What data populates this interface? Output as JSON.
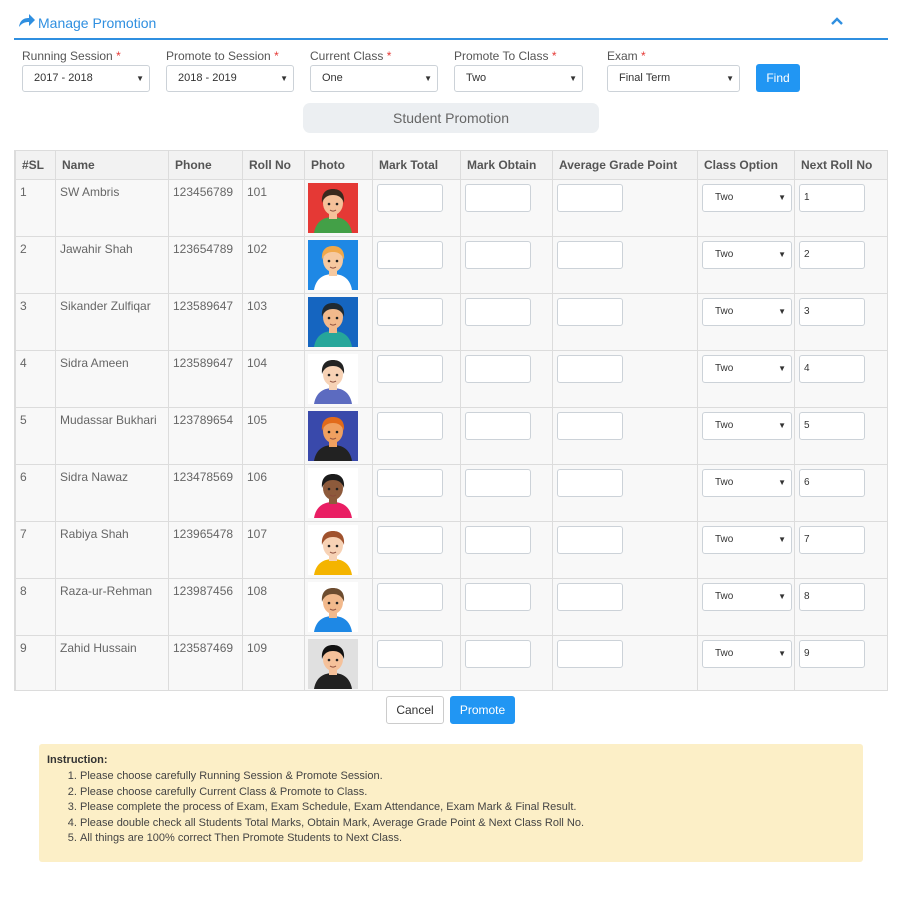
{
  "header": {
    "title": "Manage Promotion"
  },
  "filters": [
    {
      "label": "Running Session",
      "value": "2017 - 2018"
    },
    {
      "label": "Promote to Session",
      "value": "2018 - 2019"
    },
    {
      "label": "Current Class",
      "value": "One"
    },
    {
      "label": "Promote To Class",
      "value": "Two"
    },
    {
      "label": "Exam",
      "value": "Final Term"
    }
  ],
  "required_marker": "*",
  "find_label": "Find",
  "section_title": "Student Promotion",
  "table": {
    "columns": [
      "#SL",
      "Name",
      "Phone",
      "Roll No",
      "Photo",
      "Mark Total",
      "Mark Obtain",
      "Average Grade Point",
      "Class Option",
      "Next Roll No"
    ],
    "rows": [
      {
        "sl": "1",
        "name": "SW Ambris",
        "phone": "123456789",
        "roll": "101",
        "class_option": "Two",
        "next_roll": "1"
      },
      {
        "sl": "2",
        "name": "Jawahir Shah",
        "phone": "123654789",
        "roll": "102",
        "class_option": "Two",
        "next_roll": "2"
      },
      {
        "sl": "3",
        "name": "Sikander Zulfiqar",
        "phone": "123589647",
        "roll": "103",
        "class_option": "Two",
        "next_roll": "3"
      },
      {
        "sl": "4",
        "name": "Sidra Ameen",
        "phone": "123589647",
        "roll": "104",
        "class_option": "Two",
        "next_roll": "4"
      },
      {
        "sl": "5",
        "name": "Mudassar Bukhari",
        "phone": "123789654",
        "roll": "105",
        "class_option": "Two",
        "next_roll": "5"
      },
      {
        "sl": "6",
        "name": "Sidra Nawaz",
        "phone": "123478569",
        "roll": "106",
        "class_option": "Two",
        "next_roll": "6"
      },
      {
        "sl": "7",
        "name": "Rabiya Shah",
        "phone": "123965478",
        "roll": "107",
        "class_option": "Two",
        "next_roll": "7"
      },
      {
        "sl": "8",
        "name": "Raza-ur-Rehman",
        "phone": "123987456",
        "roll": "108",
        "class_option": "Two",
        "next_roll": "8"
      },
      {
        "sl": "9",
        "name": "Zahid Hussain",
        "phone": "123587469",
        "roll": "109",
        "class_option": "Two",
        "next_roll": "9"
      }
    ]
  },
  "avatars": [
    {
      "bg": "#e53935",
      "skin": "#f5c19a",
      "hair": "#3a2a1e",
      "shirt": "#43a047"
    },
    {
      "bg": "#1e88e5",
      "skin": "#f6c9a0",
      "hair": "#f0a84a",
      "shirt": "#ffffff"
    },
    {
      "bg": "#1565c0",
      "skin": "#f2b98c",
      "hair": "#1f2a33",
      "shirt": "#26a69a"
    },
    {
      "bg": "#ffffff",
      "skin": "#f7d2b5",
      "hair": "#222222",
      "shirt": "#5c6bc0"
    },
    {
      "bg": "#3949ab",
      "skin": "#f0a060",
      "hair": "#e26a1a",
      "shirt": "#222222"
    },
    {
      "bg": "#ffffff",
      "skin": "#8d5a3b",
      "hair": "#1b1b1b",
      "shirt": "#e91e63"
    },
    {
      "bg": "#ffffff",
      "skin": "#f7d2b5",
      "hair": "#a0522d",
      "shirt": "#f4b400"
    },
    {
      "bg": "#ffffff",
      "skin": "#f2b98c",
      "hair": "#6d4c2f",
      "shirt": "#1e88e5"
    },
    {
      "bg": "#e0e0e0",
      "skin": "#f5c19a",
      "hair": "#111111",
      "shirt": "#212121"
    }
  ],
  "buttons": {
    "cancel": "Cancel",
    "promote": "Promote"
  },
  "instruction": {
    "title": "Instruction:",
    "items": [
      "Please choose carefully Running Session & Promote Session.",
      "Please choose carefully Current Class & Promote to Class.",
      "Please complete the process of Exam, Exam Schedule, Exam Attendance, Exam Mark & Final Result.",
      "Please double check all Students Total Marks, Obtain Mark, Average Grade Point & Next Class Roll No.",
      "All things are 100% correct Then Promote Students to Next Class."
    ]
  },
  "colors": {
    "accent": "#2196f3",
    "instruction_bg": "#fcefc7",
    "required": "#e53935"
  },
  "icons": {
    "header": "share-icon",
    "collapse": "chevron-up-icon",
    "select": "caret-down-icon"
  }
}
